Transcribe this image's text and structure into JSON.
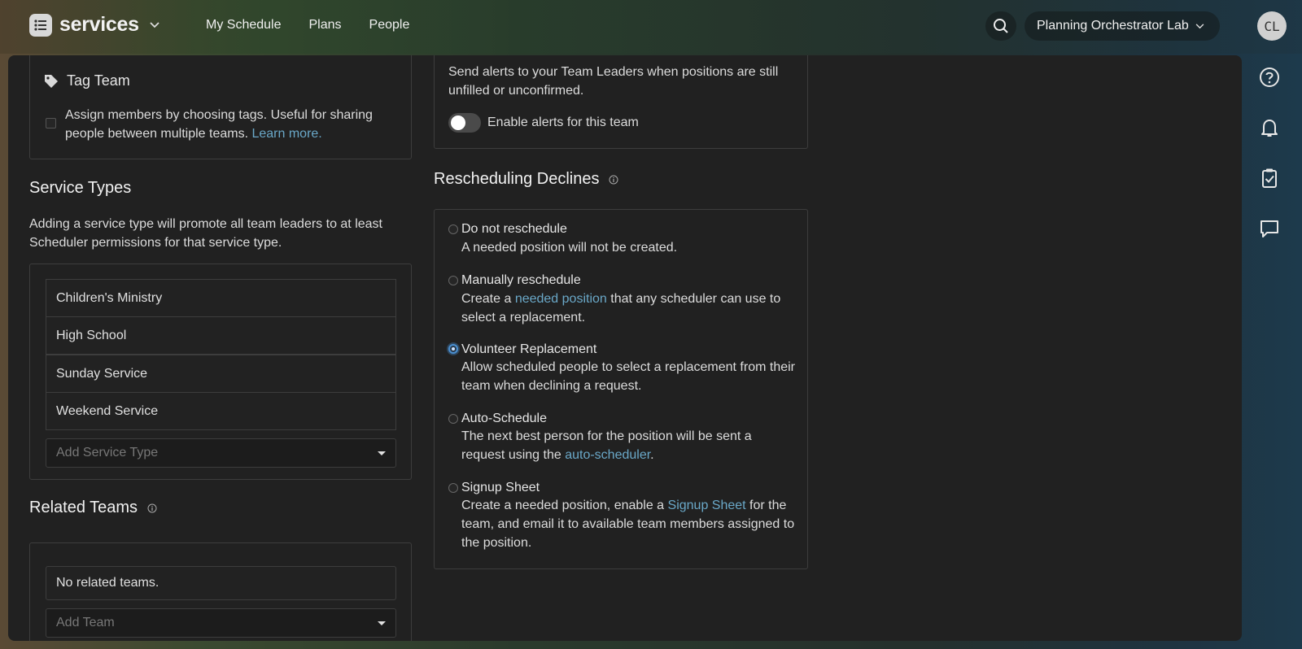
{
  "header": {
    "brand": "services",
    "nav": [
      "My Schedule",
      "Plans",
      "People"
    ],
    "org_name": "Planning Orchestrator Lab",
    "avatar_initials": "CL"
  },
  "tag_team": {
    "title": "Tag Team",
    "description": "Assign members by choosing tags. Useful for sharing people between multiple teams.",
    "learn_more": "Learn more."
  },
  "service_types": {
    "heading": "Service Types",
    "description": "Adding a service type will promote all team leaders to at least Scheduler permissions for that service type.",
    "items": [
      "Children's Ministry",
      "High School",
      "Sunday Service",
      "Weekend Service"
    ],
    "add_placeholder": "Add Service Type"
  },
  "related_teams": {
    "heading": "Related Teams",
    "empty": "No related teams.",
    "add_placeholder": "Add Team"
  },
  "alerts": {
    "description": "Send alerts to your Team Leaders when positions are still unfilled or unconfirmed.",
    "toggle_label": "Enable alerts for this team"
  },
  "rescheduling": {
    "heading": "Rescheduling Declines",
    "options": [
      {
        "label": "Do not reschedule",
        "desc": "A needed position will not be created."
      },
      {
        "label": "Manually reschedule",
        "desc_before": "Create a ",
        "link": "needed position",
        "desc_after": " that any scheduler can use to select a replacement."
      },
      {
        "label": "Volunteer Replacement",
        "desc": "Allow scheduled people to select a replacement from their team when declining a request."
      },
      {
        "label": "Auto-Schedule",
        "desc_before": "The next best person for the position will be sent a request using the ",
        "link": "auto-scheduler",
        "desc_after": "."
      },
      {
        "label": "Signup Sheet",
        "desc_before": "Create a needed position, enable a ",
        "link": "Signup Sheet",
        "desc_after": " for the team, and email it to available team members assigned to the position."
      }
    ],
    "selected_index": 2
  },
  "icons": [
    "list-icon",
    "chevron-down-icon",
    "search-icon",
    "tag-icon",
    "info-icon",
    "help-icon",
    "bell-icon",
    "clipboard-check-icon",
    "chat-icon"
  ]
}
